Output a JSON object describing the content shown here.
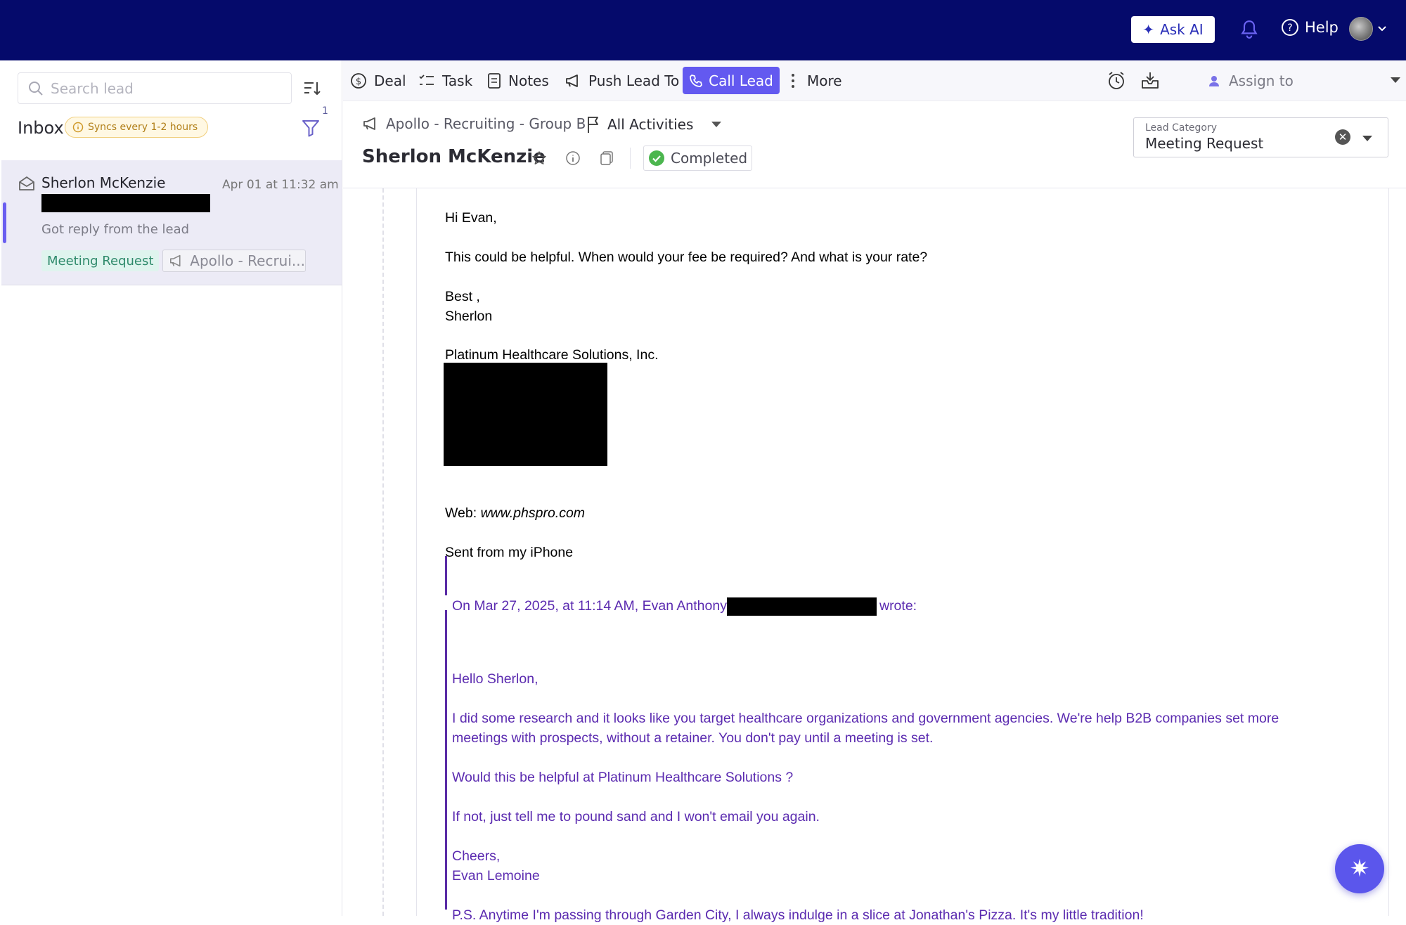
{
  "topbar": {
    "ask_ai_label": "Ask AI",
    "help_label": "Help",
    "icons": [
      "sparkle-icon",
      "bell-icon",
      "help-circle-icon",
      "avatar",
      "chevron-down-icon"
    ]
  },
  "sidebar": {
    "search_placeholder": "Search lead",
    "inbox_title": "Inbox",
    "sync_badge": "Syncs every 1-2 hours",
    "filter_count": "1",
    "leads": [
      {
        "name": "Sherlon McKenzie",
        "time": "Apr 01 at 11:32 am",
        "snippet": "Got reply from the lead",
        "category_tag": "Meeting Request",
        "campaign_tag": "Apollo - Recrui..."
      }
    ]
  },
  "toolbar": {
    "deal": "Deal",
    "task": "Task",
    "notes": "Notes",
    "push_lead": "Push Lead To",
    "call_lead": "Call Lead",
    "more": "More",
    "assign_to": "Assign to"
  },
  "lead_header": {
    "campaign": "Apollo - Recruiting - Group B",
    "activities_filter": "All Activities",
    "name": "Sherlon McKenzie",
    "status": "Completed",
    "category_label": "Lead Category",
    "category_value": "Meeting Request"
  },
  "email": {
    "greeting": "Hi Evan,",
    "line1": "This could be helpful. When would your fee be required? And what is your rate?",
    "signoff": "Best ,",
    "signer": "Sherlon",
    "company": "Platinum Healthcare Solutions, Inc.",
    "web_label": "Web: ",
    "web_url": "www.phspro.com",
    "sent_from": "Sent from my iPhone",
    "quote_header_prefix": "On Mar 27, 2025, at 11:14 AM, Evan Anthony",
    "quote_header_suffix": "wrote:",
    "quote_greeting": "Hello Sherlon,",
    "quote_para1_line1": "I did some research and it looks like you target healthcare organizations and government agencies. We're help B2B companies set more",
    "quote_para1_line2": "meetings with prospects, without a retainer. You don't pay until a meeting is set.",
    "quote_para2": "Would this be helpful at Platinum Healthcare Solutions ?",
    "quote_para3": "If not, just tell me to pound sand and I won't email you again.",
    "quote_signoff": "Cheers,",
    "quote_signer": "Evan Lemoine",
    "quote_ps": "P.S. Anytime I'm passing through Garden City, I always indulge in a slice at Jonathan's Pizza. It's my little tradition!"
  },
  "colors": {
    "topbar_bg": "#050a6b",
    "accent": "#6359f0",
    "quote_text": "#5b2bb0"
  }
}
